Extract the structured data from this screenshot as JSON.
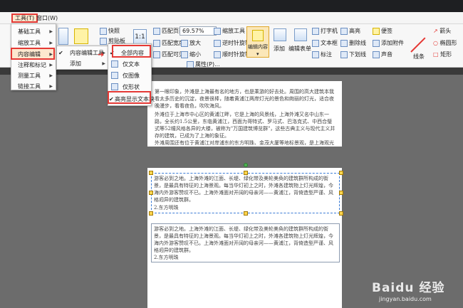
{
  "menubar": {
    "tools": "工具(T)",
    "window": "窗口(W)"
  },
  "ribbon": {
    "snapshot": "快照",
    "clipboard": "剪贴板",
    "fit_page": "匹配页面",
    "fit_width": "匹配宽度",
    "fit_visible": "匹配可见",
    "zoom_value": "69.57%",
    "zoom_in": "放大",
    "zoom_out": "缩小",
    "zoom_tool": "缩放工具",
    "rotate_cw": "逆时针旋转",
    "rotate_ccw": "顺时针旋转",
    "edit_content": "编辑内容",
    "add": "添加",
    "edit_form": "编辑表单",
    "typewriter": "打字机",
    "textbox": "文本框",
    "callout": "标注",
    "highlight": "高亮",
    "strikeout": "删除线",
    "underline": "下划线",
    "sticky_note": "便签",
    "add_attachment": "添加附件",
    "sound": "声音",
    "arrow": "箭头",
    "oval": "椭圆形",
    "rectangle": "矩形",
    "line": "线条",
    "properties": "属性(P)..."
  },
  "menus": {
    "tools": [
      "基础工具",
      "缩放工具",
      "内容编辑",
      "注释和标记",
      "测量工具",
      "链接工具"
    ],
    "content_edit": [
      "内容编辑工具",
      "添加"
    ],
    "content_edit_tools": [
      "全部内容",
      "仅文本",
      "仅图像",
      "仅形状",
      "高亮显示文本块"
    ]
  },
  "document": {
    "page1_para1": "第一眼印象，外滩是上海最有名的地方，也是乘游的好去处。周围的高大建筑本我看太多历史的沉淀，夜景很棒，随着黄浦江两岸灯光的景色和绚丽的灯光，适合夜晚漫步，看看夜色，吹吹海风。",
    "page1_para2": "外滩位于上海市中心区的黄浦江畔，它是上海的风景线，上海外滩又名中山东一路，全长约1.5公里，东临黄浦江，西面为哥特式、罗马式、巴洛克式、中西合璧式等52幢风格各异的大楼，被称为\"万国建筑博览群\"，这些古典主义与现代主义并存的建筑，已成为了上海的象征。",
    "page1_para3": "外滩周围还有位于黄浦江对岸浦东的东方明珠、金茂大厦等地标景观，是上海观光的",
    "block1_text": "游客必到之地。上海外滩的江面、长堤、绿化带及美轮美奂的建筑群所构成的街景，是最具有特征的上海景观。每当华灯初上之时，外滩各建筑物上灯光辉煌，今海内外游客赞叹不已。上海外滩面对开阔的母亲河——黄浦江，背倚造型严谨、风格迥异的建筑群。",
    "block1_heading": "2.东方明珠",
    "block2_text": "游客必到之地。上海外滩的江面、长堤、绿化带及美轮美奂的建筑群所构成的街景，是最具有特征的上海景观。每当华灯初上之时，外滩各建筑物上灯光辉煌，今海内外游客赞叹不已。上海外滩面对开阔的母亲河——黄浦江，背倚造型严谨、风格迥异的建筑群。",
    "block2_heading": "2.东方明珠"
  },
  "watermark": {
    "logo": "Baidu 经验",
    "url": "jingyan.baidu.com"
  },
  "colors": {
    "highlight_red": "#e53935",
    "menu_hover": "#fde8cf",
    "selection_blue": "#3a7bd5"
  }
}
